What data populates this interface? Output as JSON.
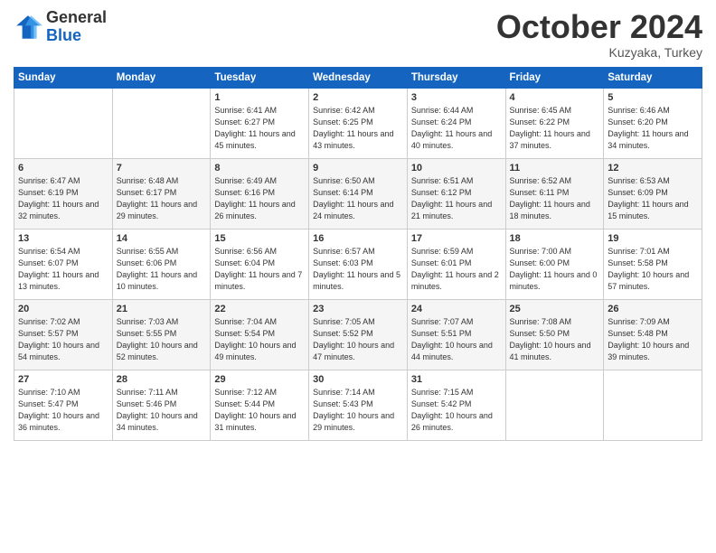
{
  "logo": {
    "general": "General",
    "blue": "Blue"
  },
  "header": {
    "month": "October 2024",
    "location": "Kuzyaka, Turkey"
  },
  "weekdays": [
    "Sunday",
    "Monday",
    "Tuesday",
    "Wednesday",
    "Thursday",
    "Friday",
    "Saturday"
  ],
  "weeks": [
    [
      {
        "day": "",
        "info": ""
      },
      {
        "day": "",
        "info": ""
      },
      {
        "day": "1",
        "sunrise": "6:41 AM",
        "sunset": "6:27 PM",
        "daylight": "11 hours and 45 minutes."
      },
      {
        "day": "2",
        "sunrise": "6:42 AM",
        "sunset": "6:25 PM",
        "daylight": "11 hours and 43 minutes."
      },
      {
        "day": "3",
        "sunrise": "6:44 AM",
        "sunset": "6:24 PM",
        "daylight": "11 hours and 40 minutes."
      },
      {
        "day": "4",
        "sunrise": "6:45 AM",
        "sunset": "6:22 PM",
        "daylight": "11 hours and 37 minutes."
      },
      {
        "day": "5",
        "sunrise": "6:46 AM",
        "sunset": "6:20 PM",
        "daylight": "11 hours and 34 minutes."
      }
    ],
    [
      {
        "day": "6",
        "sunrise": "6:47 AM",
        "sunset": "6:19 PM",
        "daylight": "11 hours and 32 minutes."
      },
      {
        "day": "7",
        "sunrise": "6:48 AM",
        "sunset": "6:17 PM",
        "daylight": "11 hours and 29 minutes."
      },
      {
        "day": "8",
        "sunrise": "6:49 AM",
        "sunset": "6:16 PM",
        "daylight": "11 hours and 26 minutes."
      },
      {
        "day": "9",
        "sunrise": "6:50 AM",
        "sunset": "6:14 PM",
        "daylight": "11 hours and 24 minutes."
      },
      {
        "day": "10",
        "sunrise": "6:51 AM",
        "sunset": "6:12 PM",
        "daylight": "11 hours and 21 minutes."
      },
      {
        "day": "11",
        "sunrise": "6:52 AM",
        "sunset": "6:11 PM",
        "daylight": "11 hours and 18 minutes."
      },
      {
        "day": "12",
        "sunrise": "6:53 AM",
        "sunset": "6:09 PM",
        "daylight": "11 hours and 15 minutes."
      }
    ],
    [
      {
        "day": "13",
        "sunrise": "6:54 AM",
        "sunset": "6:07 PM",
        "daylight": "11 hours and 13 minutes."
      },
      {
        "day": "14",
        "sunrise": "6:55 AM",
        "sunset": "6:06 PM",
        "daylight": "11 hours and 10 minutes."
      },
      {
        "day": "15",
        "sunrise": "6:56 AM",
        "sunset": "6:04 PM",
        "daylight": "11 hours and 7 minutes."
      },
      {
        "day": "16",
        "sunrise": "6:57 AM",
        "sunset": "6:03 PM",
        "daylight": "11 hours and 5 minutes."
      },
      {
        "day": "17",
        "sunrise": "6:59 AM",
        "sunset": "6:01 PM",
        "daylight": "11 hours and 2 minutes."
      },
      {
        "day": "18",
        "sunrise": "7:00 AM",
        "sunset": "6:00 PM",
        "daylight": "11 hours and 0 minutes."
      },
      {
        "day": "19",
        "sunrise": "7:01 AM",
        "sunset": "5:58 PM",
        "daylight": "10 hours and 57 minutes."
      }
    ],
    [
      {
        "day": "20",
        "sunrise": "7:02 AM",
        "sunset": "5:57 PM",
        "daylight": "10 hours and 54 minutes."
      },
      {
        "day": "21",
        "sunrise": "7:03 AM",
        "sunset": "5:55 PM",
        "daylight": "10 hours and 52 minutes."
      },
      {
        "day": "22",
        "sunrise": "7:04 AM",
        "sunset": "5:54 PM",
        "daylight": "10 hours and 49 minutes."
      },
      {
        "day": "23",
        "sunrise": "7:05 AM",
        "sunset": "5:52 PM",
        "daylight": "10 hours and 47 minutes."
      },
      {
        "day": "24",
        "sunrise": "7:07 AM",
        "sunset": "5:51 PM",
        "daylight": "10 hours and 44 minutes."
      },
      {
        "day": "25",
        "sunrise": "7:08 AM",
        "sunset": "5:50 PM",
        "daylight": "10 hours and 41 minutes."
      },
      {
        "day": "26",
        "sunrise": "7:09 AM",
        "sunset": "5:48 PM",
        "daylight": "10 hours and 39 minutes."
      }
    ],
    [
      {
        "day": "27",
        "sunrise": "7:10 AM",
        "sunset": "5:47 PM",
        "daylight": "10 hours and 36 minutes."
      },
      {
        "day": "28",
        "sunrise": "7:11 AM",
        "sunset": "5:46 PM",
        "daylight": "10 hours and 34 minutes."
      },
      {
        "day": "29",
        "sunrise": "7:12 AM",
        "sunset": "5:44 PM",
        "daylight": "10 hours and 31 minutes."
      },
      {
        "day": "30",
        "sunrise": "7:14 AM",
        "sunset": "5:43 PM",
        "daylight": "10 hours and 29 minutes."
      },
      {
        "day": "31",
        "sunrise": "7:15 AM",
        "sunset": "5:42 PM",
        "daylight": "10 hours and 26 minutes."
      },
      {
        "day": "",
        "info": ""
      },
      {
        "day": "",
        "info": ""
      }
    ]
  ]
}
